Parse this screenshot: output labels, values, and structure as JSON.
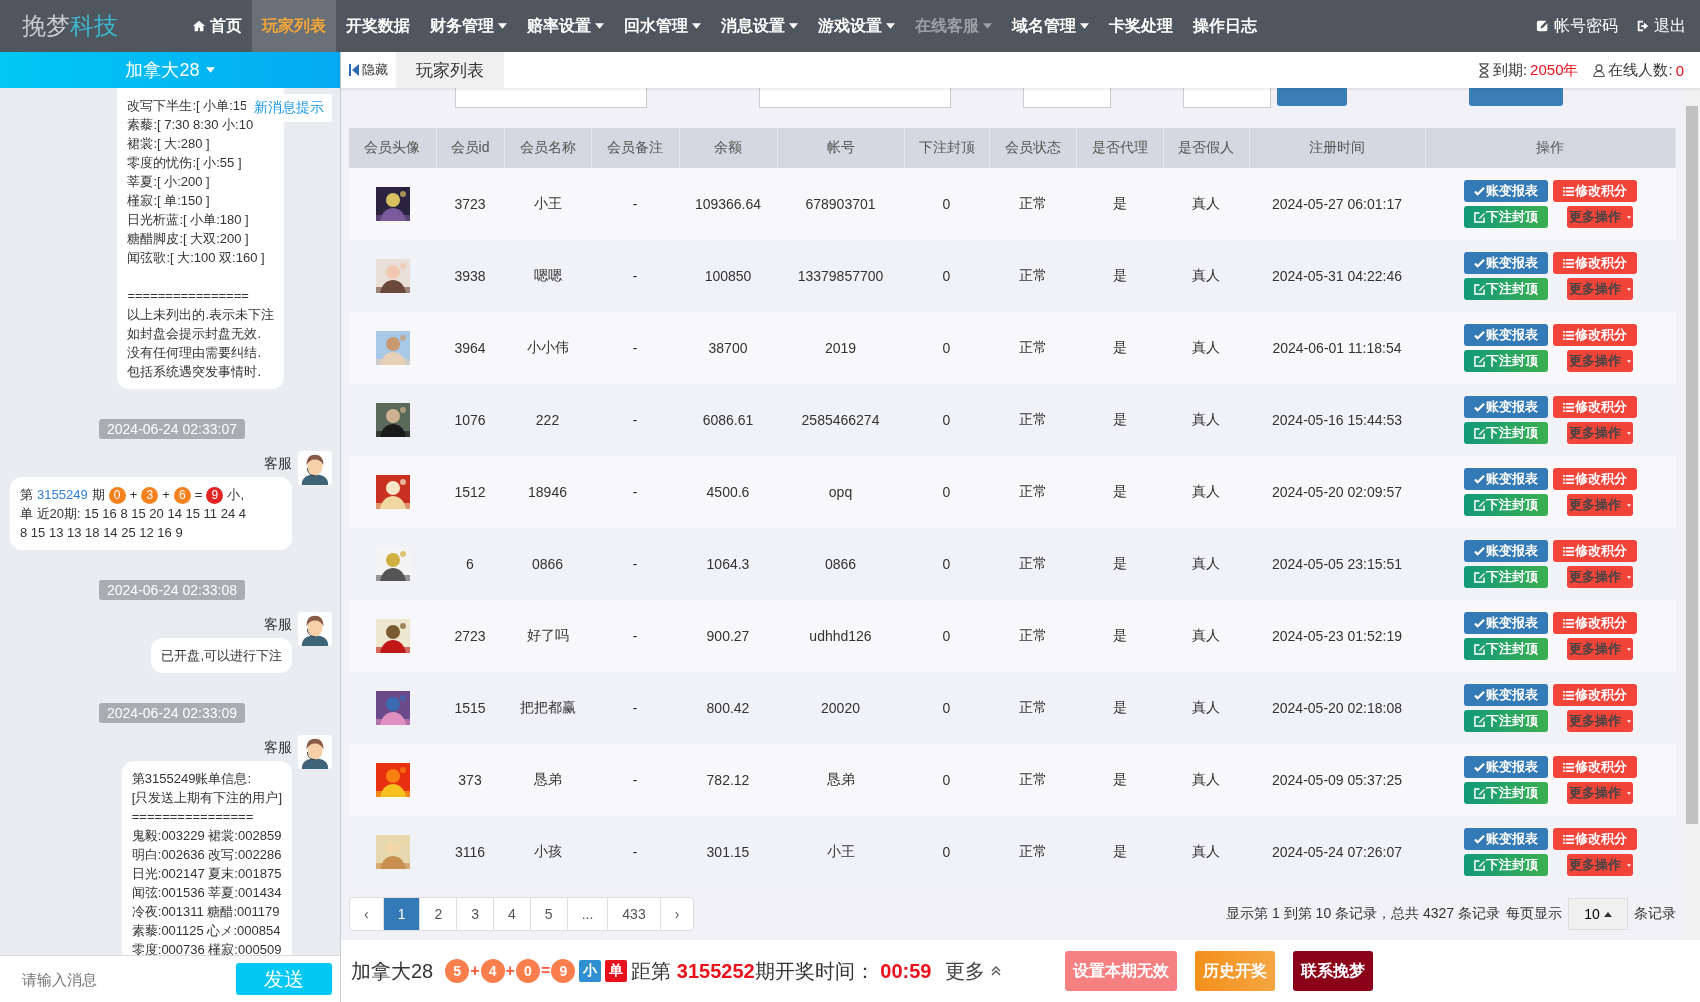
{
  "brand": {
    "name": "挽梦",
    "suffix": "科技"
  },
  "nav": [
    {
      "label": "首页",
      "selected": false,
      "disabled": false,
      "caret": false,
      "kind": "home"
    },
    {
      "label": "玩家列表",
      "selected": true,
      "disabled": false,
      "caret": false,
      "kind": "plain"
    },
    {
      "label": "开奖数据",
      "selected": false,
      "disabled": false,
      "caret": false,
      "kind": "plain"
    },
    {
      "label": "财务管理",
      "selected": false,
      "disabled": false,
      "caret": true,
      "kind": "plain"
    },
    {
      "label": "赔率设置",
      "selected": false,
      "disabled": false,
      "caret": true,
      "kind": "plain"
    },
    {
      "label": "回水管理",
      "selected": false,
      "disabled": false,
      "caret": true,
      "kind": "plain"
    },
    {
      "label": "消息设置",
      "selected": false,
      "disabled": false,
      "caret": true,
      "kind": "plain"
    },
    {
      "label": "游戏设置",
      "selected": false,
      "disabled": false,
      "caret": true,
      "kind": "plain"
    },
    {
      "label": "在线客服",
      "selected": false,
      "disabled": true,
      "caret": true,
      "kind": "plain"
    },
    {
      "label": "域名管理",
      "selected": false,
      "disabled": false,
      "caret": true,
      "kind": "plain"
    },
    {
      "label": "卡奖处理",
      "selected": false,
      "disabled": false,
      "caret": false,
      "kind": "plain"
    },
    {
      "label": "操作日志",
      "selected": false,
      "disabled": false,
      "caret": false,
      "kind": "plain"
    }
  ],
  "nav_right": [
    {
      "label": "帐号密码",
      "kind": "password"
    },
    {
      "label": "退出",
      "kind": "logout"
    }
  ],
  "sidebar": {
    "channel": "加拿大28",
    "new_message_tip": "新消息提示",
    "messages": [
      {
        "kind": "text",
        "paragraphs": [
          [
            "改写下半生:[ 小单:15",
            "素藜:[ 7:30 8:30 小:10",
            "裙裳:[ 大:280 ]",
            "零度的忧伤:[ 小:55 ]",
            "莘夏:[ 小:200 ]",
            "槿寂:[ 单:150 ]",
            "日光析蓝:[ 小单:180 ]",
            "糖醋脚皮:[ 大双:200 ]",
            "闻弦歌:[ 大:100 双:160 ]"
          ],
          [
            "================",
            "以上未列出的.表示未下注",
            "如封盘会提示封盘无效.",
            "没有任何理由需要纠结.",
            "包括系统遇突发事情时."
          ]
        ]
      },
      {
        "kind": "time",
        "text": "2024-06-24 02:33:07"
      },
      {
        "kind": "draw",
        "sender": "客服",
        "tokens": [
          {
            "kind": "text",
            "text": "第"
          },
          {
            "kind": "issue",
            "text": "3155249"
          },
          {
            "kind": "text",
            "text": "期"
          },
          {
            "kind": "ball",
            "text": "0",
            "color": "#f5821f"
          },
          {
            "kind": "op",
            "text": "+"
          },
          {
            "kind": "ball",
            "text": "3",
            "color": "#f5821f"
          },
          {
            "kind": "op",
            "text": "+"
          },
          {
            "kind": "ball",
            "text": "6",
            "color": "#f5821f"
          },
          {
            "kind": "op",
            "text": "="
          },
          {
            "kind": "ball",
            "text": "9",
            "color": "#e02424"
          },
          {
            "kind": "text",
            "text": "小,"
          },
          {
            "kind": "text",
            "text": "单 近20期: 15 16 8 15 20 14 15 11 24 4"
          },
          {
            "kind": "text",
            "text": "8 15 13 13 18 14 25 12 16 9"
          }
        ]
      },
      {
        "kind": "time",
        "text": "2024-06-24 02:33:08"
      },
      {
        "kind": "text",
        "sender": "客服",
        "paragraphs": [
          [
            "已开盘,可以进行下注"
          ]
        ]
      },
      {
        "kind": "time",
        "text": "2024-06-24 02:33:09"
      },
      {
        "kind": "text",
        "sender": "客服",
        "paragraphs": [
          [
            "第3155249账单信息:",
            "[只发送上期有下注的用户]",
            "================",
            "鬼毅:003229 裙裳:002859",
            "明白:002636 改写:002286",
            "日光:002147 夏末:001875",
            "闻弦:001536 莘夏:001434",
            "冷夜:001311 糖醋:001179",
            "素藜:001125 心メ:000854",
            "零度:000736 槿寂:000509"
          ]
        ]
      }
    ],
    "input_placeholder": "请输入消息",
    "send": "发送"
  },
  "tabbar": {
    "hide": "隐藏",
    "tab": "玩家列表",
    "expire_label": "到期:",
    "expire": "2050年",
    "online_label": "在线人数:",
    "online": "0"
  },
  "table": {
    "columns": [
      "会员头像",
      "会员id",
      "会员名称",
      "会员备注",
      "余额",
      "帐号",
      "下注封顶",
      "会员状态",
      "是否代理",
      "是否假人",
      "注册时间",
      "操作"
    ],
    "rows": [
      {
        "id": "3723",
        "name": "小王",
        "note": "-",
        "balance": "109366.64",
        "account": "678903701",
        "cap": "0",
        "status": "正常",
        "agent": "是",
        "fake": "真人",
        "time": "2024-05-27 06:01:17",
        "actions": [
          {
            "kind": "report",
            "label": "账变报表"
          },
          {
            "kind": "edit",
            "label": "修改积分"
          },
          {
            "kind": "cap",
            "label": "下注封顶"
          },
          {
            "kind": "more",
            "label": "更多操作"
          }
        ]
      },
      {
        "id": "3938",
        "name": "嗯嗯",
        "note": "-",
        "balance": "100850",
        "account": "13379857700",
        "cap": "0",
        "status": "正常",
        "agent": "是",
        "fake": "真人",
        "time": "2024-05-31 04:22:46",
        "actions": [
          {
            "kind": "report",
            "label": "账变报表"
          },
          {
            "kind": "edit",
            "label": "修改积分"
          },
          {
            "kind": "cap",
            "label": "下注封顶"
          },
          {
            "kind": "more",
            "label": "更多操作"
          }
        ]
      },
      {
        "id": "3964",
        "name": "小小伟",
        "note": "-",
        "balance": "38700",
        "account": "2019",
        "cap": "0",
        "status": "正常",
        "agent": "是",
        "fake": "真人",
        "time": "2024-06-01 11:18:54",
        "actions": [
          {
            "kind": "report",
            "label": "账变报表"
          },
          {
            "kind": "edit",
            "label": "修改积分"
          },
          {
            "kind": "cap",
            "label": "下注封顶"
          },
          {
            "kind": "more",
            "label": "更多操作"
          }
        ]
      },
      {
        "id": "1076",
        "name": "222",
        "note": "-",
        "balance": "6086.61",
        "account": "2585466274",
        "cap": "0",
        "status": "正常",
        "agent": "是",
        "fake": "真人",
        "time": "2024-05-16 15:44:53",
        "actions": [
          {
            "kind": "report",
            "label": "账变报表"
          },
          {
            "kind": "edit",
            "label": "修改积分"
          },
          {
            "kind": "cap",
            "label": "下注封顶"
          },
          {
            "kind": "more",
            "label": "更多操作"
          }
        ]
      },
      {
        "id": "1512",
        "name": "18946",
        "note": "-",
        "balance": "4500.6",
        "account": "opq",
        "cap": "0",
        "status": "正常",
        "agent": "是",
        "fake": "真人",
        "time": "2024-05-20 02:09:57",
        "actions": [
          {
            "kind": "report",
            "label": "账变报表"
          },
          {
            "kind": "edit",
            "label": "修改积分"
          },
          {
            "kind": "cap",
            "label": "下注封顶"
          },
          {
            "kind": "more",
            "label": "更多操作"
          }
        ]
      },
      {
        "id": "6",
        "name": "0866",
        "note": "-",
        "balance": "1064.3",
        "account": "0866",
        "cap": "0",
        "status": "正常",
        "agent": "是",
        "fake": "真人",
        "time": "2024-05-05 23:15:51",
        "actions": [
          {
            "kind": "report",
            "label": "账变报表"
          },
          {
            "kind": "edit",
            "label": "修改积分"
          },
          {
            "kind": "cap",
            "label": "下注封顶"
          },
          {
            "kind": "more",
            "label": "更多操作"
          }
        ]
      },
      {
        "id": "2723",
        "name": "好了吗",
        "note": "-",
        "balance": "900.27",
        "account": "udhhd126",
        "cap": "0",
        "status": "正常",
        "agent": "是",
        "fake": "真人",
        "time": "2024-05-23 01:52:19",
        "actions": [
          {
            "kind": "report",
            "label": "账变报表"
          },
          {
            "kind": "edit",
            "label": "修改积分"
          },
          {
            "kind": "cap",
            "label": "下注封顶"
          },
          {
            "kind": "more",
            "label": "更多操作"
          }
        ]
      },
      {
        "id": "1515",
        "name": "把把都赢",
        "note": "-",
        "balance": "800.42",
        "account": "20020",
        "cap": "0",
        "status": "正常",
        "agent": "是",
        "fake": "真人",
        "time": "2024-05-20 02:18:08",
        "actions": [
          {
            "kind": "report",
            "label": "账变报表"
          },
          {
            "kind": "edit",
            "label": "修改积分"
          },
          {
            "kind": "cap",
            "label": "下注封顶"
          },
          {
            "kind": "more",
            "label": "更多操作"
          }
        ]
      },
      {
        "id": "373",
        "name": "恳弟",
        "note": "-",
        "balance": "782.12",
        "account": "恳弟",
        "cap": "0",
        "status": "正常",
        "agent": "是",
        "fake": "真人",
        "time": "2024-05-09 05:37:25",
        "actions": [
          {
            "kind": "report",
            "label": "账变报表"
          },
          {
            "kind": "edit",
            "label": "修改积分"
          },
          {
            "kind": "cap",
            "label": "下注封顶"
          },
          {
            "kind": "more",
            "label": "更多操作"
          }
        ]
      },
      {
        "id": "3116",
        "name": "小孩",
        "note": "-",
        "balance": "301.15",
        "account": "小王",
        "cap": "0",
        "status": "正常",
        "agent": "是",
        "fake": "真人",
        "time": "2024-05-24 07:26:07",
        "actions": [
          {
            "kind": "report",
            "label": "账变报表"
          },
          {
            "kind": "edit",
            "label": "修改积分"
          },
          {
            "kind": "cap",
            "label": "下注封顶"
          },
          {
            "kind": "more",
            "label": "更多操作"
          }
        ]
      }
    ]
  },
  "pagination": {
    "pages": [
      {
        "label": "‹",
        "selected": false
      },
      {
        "label": "1",
        "selected": true
      },
      {
        "label": "2",
        "selected": false
      },
      {
        "label": "3",
        "selected": false
      },
      {
        "label": "4",
        "selected": false
      },
      {
        "label": "5",
        "selected": false
      },
      {
        "label": "...",
        "selected": false
      },
      {
        "label": "433",
        "selected": false
      },
      {
        "label": "›",
        "selected": false
      }
    ],
    "info": "显示第 1 到第 10 条记录，总共 4327 条记录",
    "per_page_label": "每页显示",
    "per_page": "10",
    "per_page_suffix": "条记录"
  },
  "draw_bar": {
    "game": "加拿大28",
    "tokens": [
      {
        "kind": "ball",
        "text": "5"
      },
      {
        "kind": "op",
        "text": "+"
      },
      {
        "kind": "ball",
        "text": "4"
      },
      {
        "kind": "op",
        "text": "+"
      },
      {
        "kind": "ball",
        "text": "0"
      },
      {
        "kind": "op",
        "text": "="
      },
      {
        "kind": "ball",
        "text": "9"
      }
    ],
    "tags": [
      {
        "label": "小",
        "color": "#2f8fd0"
      },
      {
        "label": "单",
        "color": "#e8111b"
      }
    ],
    "countdown_prefix": "距第",
    "issue": "3155252",
    "countdown_label": "期开奖时间：",
    "countdown": "00:59",
    "more": "更多",
    "buttons": [
      {
        "label": "设置本期无效",
        "kind": "void"
      },
      {
        "label": "历史开奖",
        "kind": "history"
      },
      {
        "label": "联系挽梦",
        "kind": "contact"
      }
    ]
  }
}
